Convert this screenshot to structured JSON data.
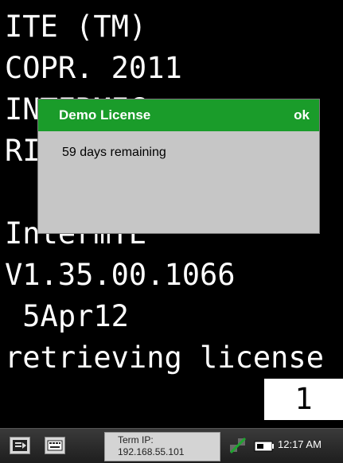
{
  "terminal": {
    "lines": [
      "ITE (TM)",
      "COPR. 2011",
      "INTERMEC  ...",
      "RI",
      "",
      "IntermTE",
      "V1.35.00.1066",
      " 5Apr12",
      "retrieving license"
    ],
    "cursor_value": "1"
  },
  "dialog": {
    "title": "Demo License",
    "ok_label": "ok",
    "message": "59 days remaining",
    "title_color": "#1a9c2a"
  },
  "taskbar": {
    "ip_label": "Term IP:",
    "ip_value": "192.168.55.101",
    "clock": "12:17 AM",
    "icons": [
      "start-menu-icon",
      "keyboard-icon",
      "network-icon",
      "battery-icon"
    ]
  }
}
